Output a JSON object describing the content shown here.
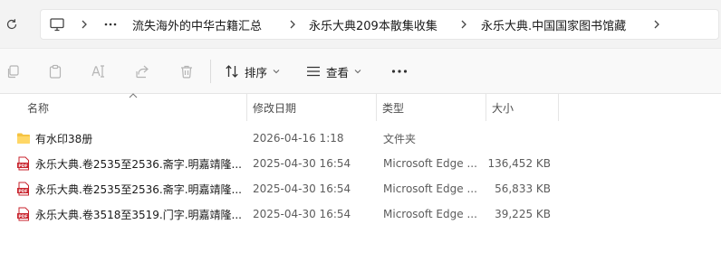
{
  "breadcrumb": {
    "items": [
      "流失海外的中华古籍汇总",
      "永乐大典209本散集收集",
      "永乐大典.中国国家图书馆藏"
    ]
  },
  "toolbar": {
    "sort_label": "排序",
    "view_label": "查看"
  },
  "columns": {
    "name": "名称",
    "date": "修改日期",
    "type": "类型",
    "size": "大小"
  },
  "files": [
    {
      "name": "有水印38册",
      "date": "2026-04-16 1:18",
      "type": "文件夹",
      "size": "",
      "icon": "folder-icon"
    },
    {
      "name": "永乐大典.卷2535至2536.斋字.明嘉靖隆...",
      "date": "2025-04-30 16:54",
      "type": "Microsoft Edge ...",
      "size": "136,452 KB",
      "icon": "pdf-icon"
    },
    {
      "name": "永乐大典.卷2535至2536.斋字.明嘉靖隆...",
      "date": "2025-04-30 16:54",
      "type": "Microsoft Edge ...",
      "size": "56,833 KB",
      "icon": "pdf-icon"
    },
    {
      "name": "永乐大典.卷3518至3519.门字.明嘉靖隆...",
      "date": "2025-04-30 16:54",
      "type": "Microsoft Edge ...",
      "size": "39,225 KB",
      "icon": "pdf-icon"
    }
  ],
  "colors": {
    "accent": "#0067c0",
    "pdf_red": "#c8232c",
    "folder_yellow": "#f5c342"
  }
}
